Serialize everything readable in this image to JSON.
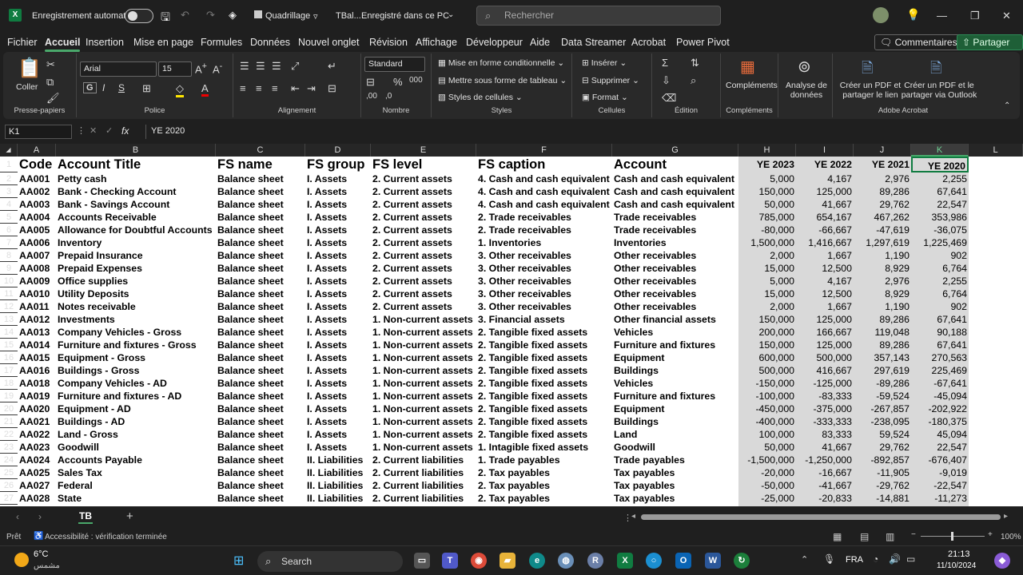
{
  "titlebar": {
    "autosave_label": "Enregistrement automatique",
    "grid_label": "Quadrillage",
    "file_name": "TBal...",
    "save_status": "Enregistré dans ce PC",
    "search_placeholder": "Rechercher"
  },
  "tabs": [
    "Fichier",
    "Accueil",
    "Insertion",
    "Mise en page",
    "Formules",
    "Données",
    "Nouvel onglet",
    "Révision",
    "Affichage",
    "Développeur",
    "Aide",
    "Data Streamer",
    "Acrobat",
    "Power Pivot"
  ],
  "active_tab": "Accueil",
  "comments_label": "Commentaires",
  "share_label": "Partager",
  "ribbon": {
    "paste_label": "Coller",
    "clipboard_group": "Presse-papiers",
    "font_name": "Arial",
    "font_size": "15",
    "font_group": "Police",
    "alignment_group": "Alignement",
    "number_format": "Standard",
    "number_group": "Nombre",
    "cond_format": "Mise en forme conditionnelle",
    "table_format": "Mettre sous forme de tableau",
    "cell_styles": "Styles de cellules",
    "styles_group": "Styles",
    "insert": "Insérer",
    "delete": "Supprimer",
    "format": "Format",
    "cells_group": "Cellules",
    "edit_group": "Édition",
    "addins": "Compléments",
    "addins_group": "Compléments",
    "analyze": "Analyse de données",
    "pdf_link": "Créer un PDF et partager le lien",
    "pdf_outlook": "Créer un PDF et le partager via Outlook",
    "acrobat_group": "Adobe Acrobat"
  },
  "formula_bar": {
    "name_box": "K1",
    "value": "YE 2020"
  },
  "columns": [
    "A",
    "B",
    "C",
    "D",
    "E",
    "F",
    "G",
    "H",
    "I",
    "J",
    "K",
    "L"
  ],
  "selected_column": "K",
  "headers": [
    "Code",
    "Account Title",
    "FS name",
    "FS group",
    "FS level",
    "FS caption",
    "Account",
    "YE 2023",
    "YE 2022",
    "YE 2021",
    "YE 2020"
  ],
  "rows": [
    [
      "AA001",
      "Petty cash",
      "Balance sheet",
      "I. Assets",
      "2. Current assets",
      "4. Cash and cash equivalent",
      "Cash and cash equivalent",
      "5,000",
      "4,167",
      "2,976",
      "2,255"
    ],
    [
      "AA002",
      "Bank - Checking Account",
      "Balance sheet",
      "I. Assets",
      "2. Current assets",
      "4. Cash and cash equivalent",
      "Cash and cash equivalent",
      "150,000",
      "125,000",
      "89,286",
      "67,641"
    ],
    [
      "AA003",
      "Bank - Savings Account",
      "Balance sheet",
      "I. Assets",
      "2. Current assets",
      "4. Cash and cash equivalent",
      "Cash and cash equivalent",
      "50,000",
      "41,667",
      "29,762",
      "22,547"
    ],
    [
      "AA004",
      "Accounts Receivable",
      "Balance sheet",
      "I. Assets",
      "2. Current assets",
      "2. Trade receivables",
      "Trade receivables",
      "785,000",
      "654,167",
      "467,262",
      "353,986"
    ],
    [
      "AA005",
      "Allowance for Doubtful Accounts",
      "Balance sheet",
      "I. Assets",
      "2. Current assets",
      "2. Trade receivables",
      "Trade receivables",
      "-80,000",
      "-66,667",
      "-47,619",
      "-36,075"
    ],
    [
      "AA006",
      "Inventory",
      "Balance sheet",
      "I. Assets",
      "2. Current assets",
      "1. Inventories",
      "Inventories",
      "1,500,000",
      "1,416,667",
      "1,297,619",
      "1,225,469"
    ],
    [
      "AA007",
      "Prepaid Insurance",
      "Balance sheet",
      "I. Assets",
      "2. Current assets",
      "3. Other receivables",
      "Other receivables",
      "2,000",
      "1,667",
      "1,190",
      "902"
    ],
    [
      "AA008",
      "Prepaid Expenses",
      "Balance sheet",
      "I. Assets",
      "2. Current assets",
      "3. Other receivables",
      "Other receivables",
      "15,000",
      "12,500",
      "8,929",
      "6,764"
    ],
    [
      "AA009",
      "Office supplies",
      "Balance sheet",
      "I. Assets",
      "2. Current assets",
      "3. Other receivables",
      "Other receivables",
      "5,000",
      "4,167",
      "2,976",
      "2,255"
    ],
    [
      "AA010",
      "Utility Deposits",
      "Balance sheet",
      "I. Assets",
      "2. Current assets",
      "3. Other receivables",
      "Other receivables",
      "15,000",
      "12,500",
      "8,929",
      "6,764"
    ],
    [
      "AA011",
      "Notes receivable",
      "Balance sheet",
      "I. Assets",
      "2. Current assets",
      "3. Other receivables",
      "Other receivables",
      "2,000",
      "1,667",
      "1,190",
      "902"
    ],
    [
      "AA012",
      "Investments",
      "Balance sheet",
      "I. Assets",
      "1. Non-current assets",
      "3. Financial assets",
      "Other financial assets",
      "150,000",
      "125,000",
      "89,286",
      "67,641"
    ],
    [
      "AA013",
      "Company Vehicles - Gross",
      "Balance sheet",
      "I. Assets",
      "1. Non-current assets",
      "2. Tangible fixed assets",
      "Vehicles",
      "200,000",
      "166,667",
      "119,048",
      "90,188"
    ],
    [
      "AA014",
      "Furniture and fixtures - Gross",
      "Balance sheet",
      "I. Assets",
      "1. Non-current assets",
      "2. Tangible fixed assets",
      "Furniture and fixtures",
      "150,000",
      "125,000",
      "89,286",
      "67,641"
    ],
    [
      "AA015",
      "Equipment - Gross",
      "Balance sheet",
      "I. Assets",
      "1. Non-current assets",
      "2. Tangible fixed assets",
      "Equipment",
      "600,000",
      "500,000",
      "357,143",
      "270,563"
    ],
    [
      "AA016",
      "Buildings - Gross",
      "Balance sheet",
      "I. Assets",
      "1. Non-current assets",
      "2. Tangible fixed assets",
      "Buildings",
      "500,000",
      "416,667",
      "297,619",
      "225,469"
    ],
    [
      "AA018",
      "Company Vehicles - AD",
      "Balance sheet",
      "I. Assets",
      "1. Non-current assets",
      "2. Tangible fixed assets",
      "Vehicles",
      "-150,000",
      "-125,000",
      "-89,286",
      "-67,641"
    ],
    [
      "AA019",
      "Furniture and fixtures - AD",
      "Balance sheet",
      "I. Assets",
      "1. Non-current assets",
      "2. Tangible fixed assets",
      "Furniture and fixtures",
      "-100,000",
      "-83,333",
      "-59,524",
      "-45,094"
    ],
    [
      "AA020",
      "Equipment - AD",
      "Balance sheet",
      "I. Assets",
      "1. Non-current assets",
      "2. Tangible fixed assets",
      "Equipment",
      "-450,000",
      "-375,000",
      "-267,857",
      "-202,922"
    ],
    [
      "AA021",
      "Buildings - AD",
      "Balance sheet",
      "I. Assets",
      "1. Non-current assets",
      "2. Tangible fixed assets",
      "Buildings",
      "-400,000",
      "-333,333",
      "-238,095",
      "-180,375"
    ],
    [
      "AA022",
      "Land - Gross",
      "Balance sheet",
      "I. Assets",
      "1. Non-current assets",
      "2. Tangible fixed assets",
      "Land",
      "100,000",
      "83,333",
      "59,524",
      "45,094"
    ],
    [
      "AA023",
      "Goodwill",
      "Balance sheet",
      "I. Assets",
      "1. Non-current assets",
      "1. Intagible fixed assets",
      "Goodwill",
      "50,000",
      "41,667",
      "29,762",
      "22,547"
    ],
    [
      "AA024",
      "Accounts Payable",
      "Balance sheet",
      "II. Liabilities",
      "2. Current liabilities",
      "1. Trade payables",
      "Trade payables",
      "-1,500,000",
      "-1,250,000",
      "-892,857",
      "-676,407"
    ],
    [
      "AA025",
      "Sales Tax",
      "Balance sheet",
      "II. Liabilities",
      "2. Current liabilities",
      "2. Tax payables",
      "Tax payables",
      "-20,000",
      "-16,667",
      "-11,905",
      "-9,019"
    ],
    [
      "AA027",
      "Federal",
      "Balance sheet",
      "II. Liabilities",
      "2. Current liabilities",
      "2. Tax payables",
      "Tax payables",
      "-50,000",
      "-41,667",
      "-29,762",
      "-22,547"
    ],
    [
      "AA028",
      "State",
      "Balance sheet",
      "II. Liabilities",
      "2. Current liabilities",
      "2. Tax payables",
      "Tax payables",
      "-25,000",
      "-20,833",
      "-14,881",
      "-11,273"
    ]
  ],
  "sheet": {
    "name": "TB"
  },
  "status": {
    "ready": "Prêt",
    "accessibility": "Accessibilité : vérification terminée",
    "zoom": "100%"
  },
  "taskbar": {
    "weather_temp": "6°C",
    "weather_desc": "مشمس",
    "search_label": "Search",
    "lang": "FRA",
    "time": "21:13",
    "date": "11/10/2024"
  }
}
